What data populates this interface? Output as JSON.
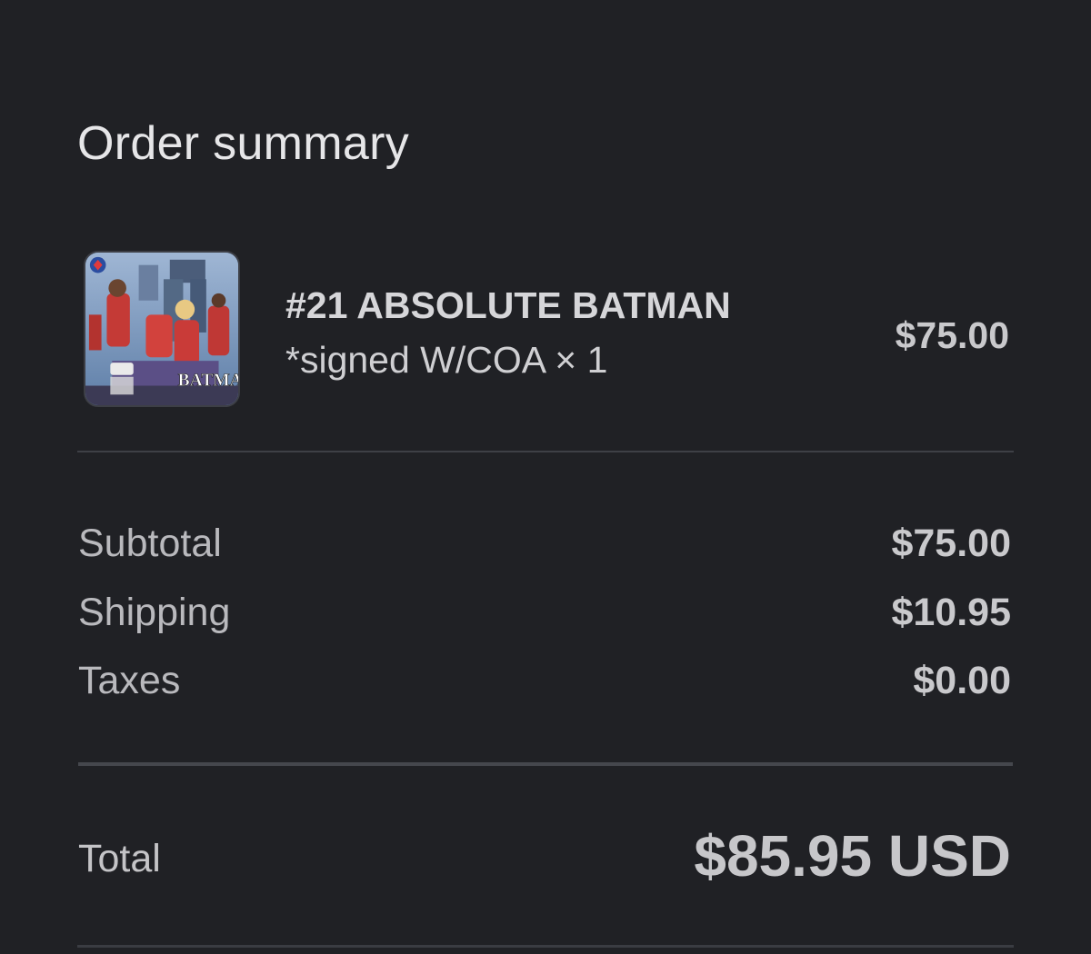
{
  "order_summary": {
    "title": "Order summary",
    "line_items": [
      {
        "name_line1": "#21 ABSOLUTE BATMAN",
        "name_line2": "*signed W/COA",
        "quantity": "× 1",
        "price": "$75.00",
        "thumbnail": {
          "icon": "comic-cover-thumbnail",
          "cover_text": "BATMAN"
        }
      }
    ],
    "subtotal": {
      "label": "Subtotal",
      "value": "$75.00"
    },
    "shipping": {
      "label": "Shipping",
      "value": "$10.95"
    },
    "taxes": {
      "label": "Taxes",
      "value": "$0.00"
    },
    "total": {
      "label": "Total",
      "value": "$85.95 USD"
    }
  },
  "colors": {
    "background": "#202125",
    "divider": "#3e4046",
    "text_primary": "#d9d9dc",
    "text_secondary": "#b9b9bd"
  }
}
